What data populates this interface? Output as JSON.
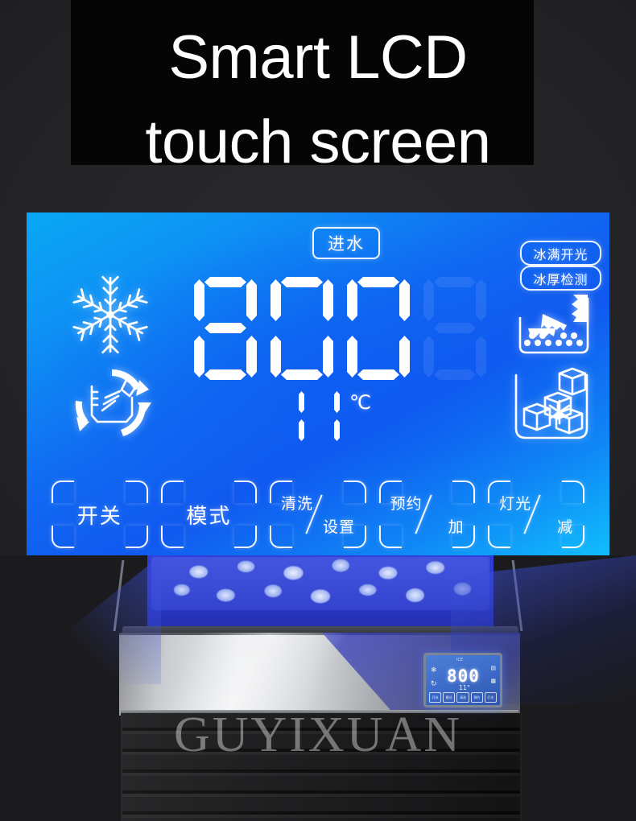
{
  "headline": {
    "text": "Smart LCD\ntouch screen"
  },
  "lcd": {
    "status_pills": [
      {
        "name": "water-inlet",
        "label": "进水"
      },
      {
        "name": "ice-full-switch",
        "label": "冰满开光"
      },
      {
        "name": "ice-thickness-detect",
        "label": "冰厚检测"
      }
    ],
    "main_display": {
      "value": "800",
      "digits": [
        "8",
        "0",
        "0"
      ],
      "ghost_digit": "8"
    },
    "temperature": {
      "value": "11",
      "digits": [
        "1",
        "1"
      ],
      "unit": "℃"
    },
    "icons": [
      {
        "name": "snowflake-icon",
        "label": "制冷"
      },
      {
        "name": "self-clean-spray-icon",
        "label": "自清洗"
      },
      {
        "name": "ice-maker-tray-icon",
        "label": "制冰"
      },
      {
        "name": "ice-cubes-bin-icon",
        "label": "冰块"
      }
    ],
    "buttons": [
      {
        "name": "power-button",
        "label": "开关",
        "sub": ""
      },
      {
        "name": "mode-button",
        "label": "模式",
        "sub": ""
      },
      {
        "name": "clean-settings-button",
        "label": "清洗",
        "sub": "设置"
      },
      {
        "name": "reserve-plus-button",
        "label": "预约",
        "sub": "加"
      },
      {
        "name": "light-minus-button",
        "label": "灯光",
        "sub": "减"
      }
    ]
  },
  "product": {
    "mini_lcd": {
      "title": "ICE",
      "digits": "800",
      "temp": "11°",
      "left_icons": [
        "❄",
        "↻"
      ],
      "right_icons": [
        "▤",
        "▦"
      ],
      "buttons": [
        "开关",
        "模式",
        "清洗",
        "预约",
        "灯光"
      ]
    }
  },
  "watermark": {
    "text": "GUYIXUAN"
  },
  "colors": {
    "lcd_cyan": "#0aa8f5",
    "lcd_blue": "#1059ef",
    "backdrop": "#232325",
    "headline_panel": "#050505",
    "text_white": "#ffffff"
  }
}
